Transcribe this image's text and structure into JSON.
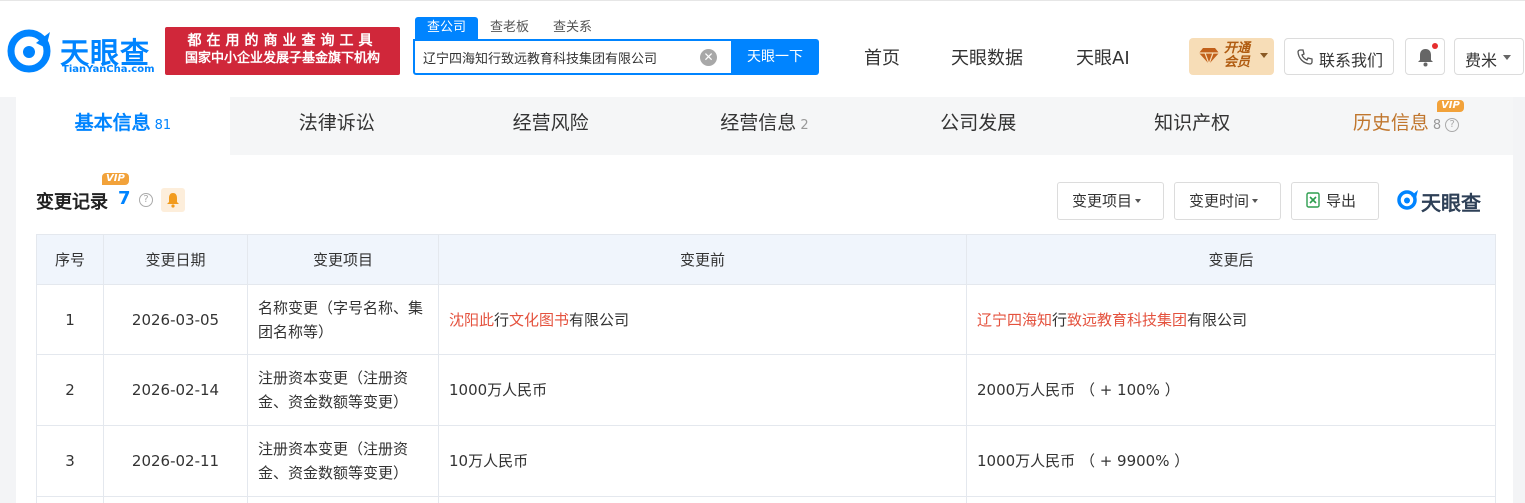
{
  "header": {
    "logo_cn": "天眼查",
    "logo_en": "TianYanCha.com",
    "slogan_line1": "都在用的商业查询工具",
    "slogan_line2": "国家中小企业发展子基金旗下机构",
    "search_tabs": [
      "查公司",
      "查老板",
      "查关系"
    ],
    "search_value": "辽宁四海知行致远教育科技集团有限公司",
    "search_button": "天眼一下",
    "nav": [
      "首页",
      "天眼数据",
      "天眼AI"
    ],
    "vip_line1": "开通",
    "vip_line2": "会员",
    "contact": "联系我们",
    "user": "费米"
  },
  "tabs": [
    {
      "label": "基本信息",
      "count": "81"
    },
    {
      "label": "法律诉讼",
      "count": ""
    },
    {
      "label": "经营风险",
      "count": ""
    },
    {
      "label": "经营信息",
      "count": "2"
    },
    {
      "label": "公司发展",
      "count": ""
    },
    {
      "label": "知识产权",
      "count": ""
    },
    {
      "label": "历史信息",
      "count": "8"
    }
  ],
  "vip_tag": "VIP",
  "section": {
    "title": "变更记录",
    "count": "7",
    "filter_item": "变更项目",
    "filter_time": "变更时间",
    "export": "导出",
    "watermark": "天眼查"
  },
  "table": {
    "headers": [
      "序号",
      "变更日期",
      "变更项目",
      "变更前",
      "变更后"
    ],
    "rows": [
      {
        "idx": "1",
        "date": "2026-03-05",
        "item": "名称变更（字号名称、集团名称等）",
        "before": {
          "p1": "沈阳此",
          "p2": "行",
          "p3": "文化图书",
          "p4": "有限公司"
        },
        "after": {
          "p1": "辽宁四海知",
          "p2": "行",
          "p3": "致远教育科技集团",
          "p4": "有限公司"
        }
      },
      {
        "idx": "2",
        "date": "2026-02-14",
        "item": "注册资本变更（注册资金、资金数额等变更）",
        "before": "1000万人民币",
        "after": "2000万人民币 （ + 100% ）"
      },
      {
        "idx": "3",
        "date": "2026-02-11",
        "item": "注册资本变更（注册资金、资金数额等变更）",
        "before": "10万人民币",
        "after": "1000万人民币 （ + 9900% ）"
      }
    ]
  },
  "colors": {
    "brand_blue": "#0084ff",
    "slogan_red": "#d0273a",
    "change_red": "#e4523e",
    "vip_gold": "#f2a23a"
  }
}
